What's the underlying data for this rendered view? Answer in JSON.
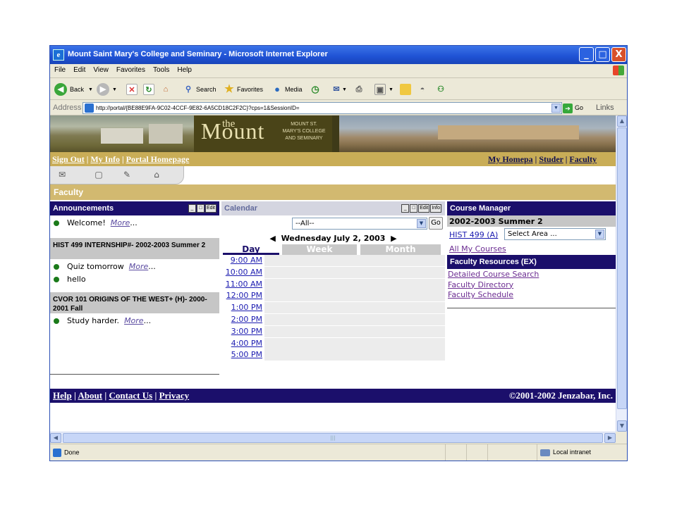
{
  "window": {
    "title": "Mount Saint Mary's College and Seminary - Microsoft Internet Explorer",
    "controls": {
      "minimize": "_",
      "maximize": "□",
      "close": "X"
    }
  },
  "menu": [
    "File",
    "Edit",
    "View",
    "Favorites",
    "Tools",
    "Help"
  ],
  "toolbar": {
    "back": "Back",
    "search": "Search",
    "favorites": "Favorites",
    "media": "Media"
  },
  "address": {
    "label": "Address",
    "url": "http://portal/{BE88E9FA-9C02-4CCF-9E82-6A5CD18C2F2C}?cps=1&SessionID=",
    "go": "Go",
    "links": "Links"
  },
  "banner": {
    "logo_the": "the",
    "logo_mount": "Mount",
    "logo_sub": [
      "MOUNT ST.",
      "MARY'S COLLEGE",
      "AND SEMINARY"
    ]
  },
  "topnav": {
    "left": [
      "Sign Out",
      "My Info",
      "Portal Homepage"
    ],
    "right": [
      "My Homepa",
      "Studer",
      "Faculty"
    ]
  },
  "section": "Faculty",
  "announcements": {
    "title": "Announcements",
    "edit": "Edit",
    "items": [
      {
        "text": "Welcome!",
        "more": "More"
      }
    ],
    "groups": [
      {
        "title": "HIST 499  INTERNSHIP#- 2002-2003 Summer 2",
        "items": [
          {
            "text": "Quiz tomorrow",
            "more": "More"
          },
          {
            "text": "hello",
            "more": ""
          }
        ]
      },
      {
        "title": "CVOR 101  ORIGINS OF THE WEST+ (H)- 2000-2001 Fall",
        "items": [
          {
            "text": "Study harder.",
            "more": "More"
          }
        ]
      }
    ]
  },
  "calendar": {
    "title": "Calendar",
    "edit": "Edit",
    "info": "Info",
    "filter": "--All--",
    "go": "Go",
    "date": "Wednesday July 2, 2003",
    "tabs": [
      "Day",
      "Week",
      "Month"
    ],
    "times": [
      "9:00 AM",
      "10:00 AM",
      "11:00 AM",
      "12:00 PM",
      "1:00 PM",
      "2:00 PM",
      "3:00 PM",
      "4:00 PM",
      "5:00 PM"
    ]
  },
  "course_manager": {
    "title": "Course Manager",
    "term": "2002-2003 Summer 2",
    "course": "HIST 499 (A)",
    "select_area": "Select Area ...",
    "all_courses": "All My Courses"
  },
  "faculty_resources": {
    "title": "Faculty Resources (EX)",
    "links": [
      "Detailed Course Search",
      "Faculty Directory",
      "Faculty Schedule"
    ]
  },
  "footer": {
    "links": [
      "Help",
      "About",
      "Contact Us",
      "Privacy"
    ],
    "copyright": "©2001-2002 Jenzabar, Inc."
  },
  "status": {
    "text": "Done",
    "zone": "Local intranet"
  }
}
